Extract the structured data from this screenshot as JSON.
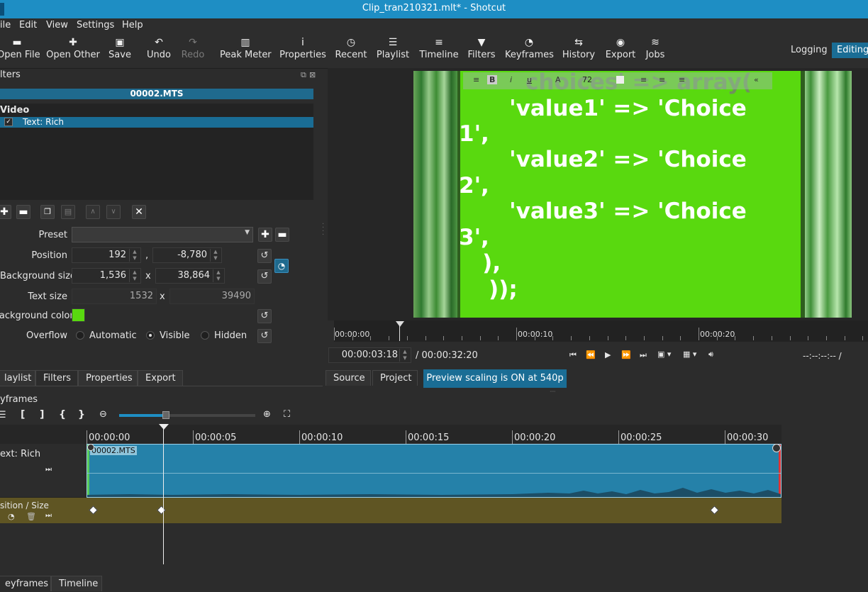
{
  "window": {
    "title": "Clip_tran210321.mlt* - Shotcut"
  },
  "menu": [
    "ile",
    "Edit",
    "View",
    "Settings",
    "Help"
  ],
  "toolbar": {
    "items": [
      {
        "label": "Open File",
        "icon": "folder-open-icon",
        "glyph": "▬"
      },
      {
        "label": "Open Other",
        "icon": "open-other-icon",
        "glyph": "✚"
      },
      {
        "label": "Save",
        "icon": "save-icon",
        "glyph": "▣"
      },
      {
        "label": "Undo",
        "icon": "undo-icon",
        "glyph": "↶"
      },
      {
        "label": "Redo",
        "icon": "redo-icon",
        "glyph": "↷"
      },
      {
        "label": "Peak Meter",
        "icon": "peak-meter-icon",
        "glyph": "▥"
      },
      {
        "label": "Properties",
        "icon": "info-icon",
        "glyph": "i"
      },
      {
        "label": "Recent",
        "icon": "clock-icon",
        "glyph": "◷"
      },
      {
        "label": "Playlist",
        "icon": "list-icon",
        "glyph": "☰"
      },
      {
        "label": "Timeline",
        "icon": "timeline-icon",
        "glyph": "≡"
      },
      {
        "label": "Filters",
        "icon": "filter-icon",
        "glyph": "▼"
      },
      {
        "label": "Keyframes",
        "icon": "stopwatch-icon",
        "glyph": "◔"
      },
      {
        "label": "History",
        "icon": "history-icon",
        "glyph": "⇆"
      },
      {
        "label": "Export",
        "icon": "disc-icon",
        "glyph": "◉"
      },
      {
        "label": "Jobs",
        "icon": "database-icon",
        "glyph": "≋"
      }
    ],
    "modes": {
      "logging": "Logging",
      "editing": "Editing"
    }
  },
  "filters": {
    "panel_title": "lters",
    "clip_name": "00002.MTS",
    "section": "Video",
    "filter_item": "Text: Rich",
    "preset_label": "Preset",
    "position_label": "Position",
    "position_x": "192",
    "position_y": "-8,780",
    "bgsize_label": "Background size",
    "bgsize_w": "1,536",
    "bgsize_h": "38,864",
    "textsize_label": "Text size",
    "textsize_w": "1532",
    "textsize_h": "39490",
    "bgcolor_label": "Background color",
    "bgcolor": "#59d90f",
    "overflow_label": "Overflow",
    "overflow_options": [
      "Automatic",
      "Visible",
      "Hidden"
    ],
    "overflow_selected": "Visible",
    "sep_comma": ",",
    "sep_x": "x"
  },
  "left_tabs": [
    "laylist",
    "Filters",
    "Properties",
    "Export"
  ],
  "player": {
    "video_lines": [
      "choices' => array(",
      "    'value1' => 'Choice",
      "1',",
      "    'value2' => 'Choice",
      "2',",
      "    'value3' => 'Choice",
      "3',",
      "    ),",
      "));"
    ],
    "font_size_field": "72",
    "ruler_labels": [
      "00:00:00",
      "00:00:10",
      "00:00:20"
    ],
    "timecode": "00:00:03:18",
    "duration": "/ 00:00:32:20",
    "in_out": "--:--:--:-- /",
    "tabs": [
      "Source",
      "Project"
    ],
    "scaling_badge": "Preview scaling is ON at 540p"
  },
  "keyframes": {
    "title": "yframes",
    "ruler_labels": [
      "00:00:00",
      "00:00:05",
      "00:00:10",
      "00:00:15",
      "00:00:20",
      "00:00:25",
      "00:00:30"
    ],
    "track_label": "ext: Rich",
    "clip_name": "00002.MTS",
    "param_label": "sition / Size",
    "keyframe_times_s": [
      0.3,
      3.5,
      29.5
    ],
    "playhead_s": 3.6
  },
  "bottom_tabs": [
    "eyframes",
    "Timeline"
  ],
  "colors": {
    "accent": "#1e8ec4",
    "clip": "#2581a9",
    "param_row": "#5f5523",
    "selection": "#1a6d95"
  }
}
